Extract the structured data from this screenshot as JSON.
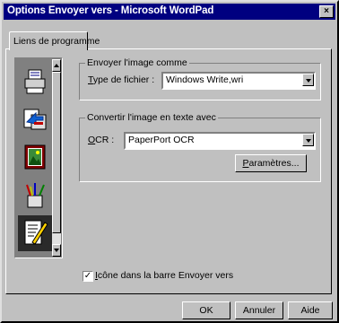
{
  "window": {
    "title": "Options Envoyer vers - Microsoft WordPad",
    "close_symbol": "×"
  },
  "tabs": [
    {
      "label": "Liens de programme"
    }
  ],
  "icon_list": {
    "items": [
      {
        "icon": "printer-icon"
      },
      {
        "icon": "fax-icon"
      },
      {
        "icon": "image-icon"
      },
      {
        "icon": "brushes-icon"
      },
      {
        "icon": "document-pen-icon",
        "selected": true
      }
    ]
  },
  "send_image": {
    "legend": "Envoyer l'image comme",
    "file_type_label_u": "T",
    "file_type_label_rest": "ype de fichier :",
    "file_type_value": "Windows Write,wri"
  },
  "ocr_group": {
    "legend": "Convertir l'image en texte avec",
    "ocr_label_u": "O",
    "ocr_label_rest": "CR :",
    "ocr_value": "PaperPort OCR",
    "params_u": "P",
    "params_rest": "aramètres..."
  },
  "checkbox": {
    "checked_mark": "✓",
    "label_u": "I",
    "label_rest": "cône dans la barre Envoyer vers"
  },
  "buttons": {
    "ok": "OK",
    "cancel": "Annuler",
    "help": "Aide"
  }
}
